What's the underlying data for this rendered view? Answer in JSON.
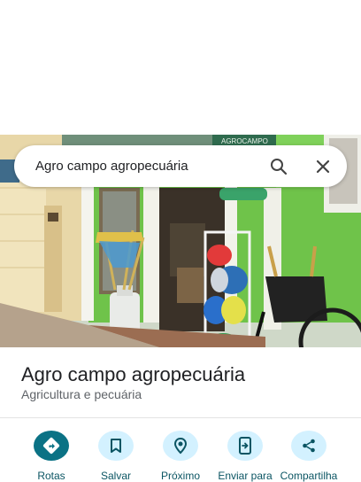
{
  "search": {
    "query": "Agro campo agropecuária"
  },
  "place": {
    "title": "Agro campo agropecuária",
    "category": "Agricultura e pecuária"
  },
  "photo": {
    "sign_text": "AGROCAMPO"
  },
  "actions": [
    {
      "label": "Rotas",
      "icon": "directions-icon"
    },
    {
      "label": "Salvar",
      "icon": "bookmark-icon"
    },
    {
      "label": "Próximo",
      "icon": "nearby-icon"
    },
    {
      "label": "Enviar para",
      "icon": "send-to-phone-icon"
    },
    {
      "label": "Compartilha",
      "icon": "share-icon"
    }
  ],
  "colors": {
    "accent": "#0b7285",
    "action_bg": "#d3f1ff",
    "action_label": "#0b5563"
  }
}
